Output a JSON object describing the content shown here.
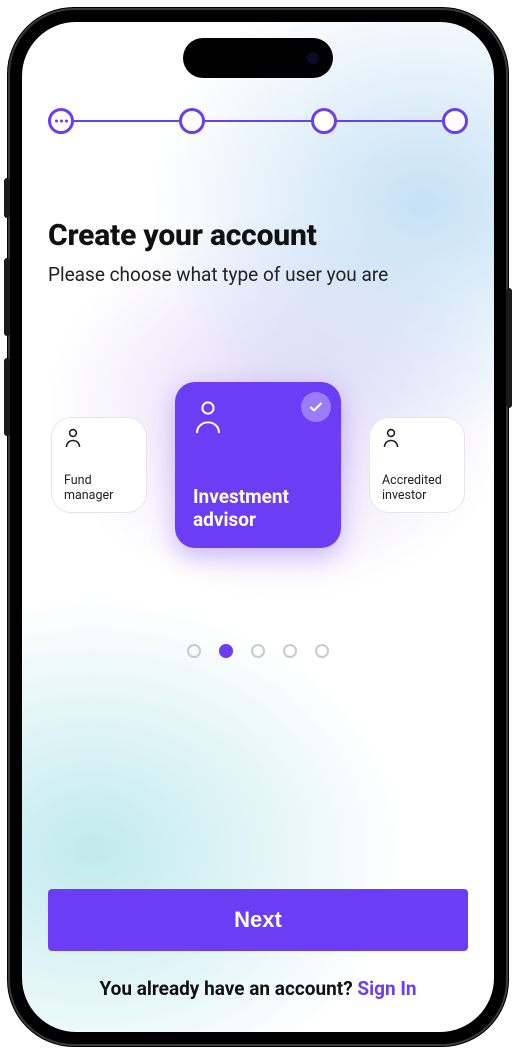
{
  "colors": {
    "accent": "#6b3df5"
  },
  "progress": {
    "steps": 4,
    "current_index": 0
  },
  "heading": {
    "title": "Create your account",
    "subtitle": "Please choose what type of user you are"
  },
  "carousel": {
    "selected_index": 1,
    "options": [
      {
        "id": "fund-manager",
        "label": "Fund manager",
        "icon": "person-icon"
      },
      {
        "id": "investment-advisor",
        "label": "Investment advisor",
        "icon": "person-icon",
        "selected": true
      },
      {
        "id": "accredited-investor",
        "label": "Accredited investor",
        "icon": "person-icon"
      }
    ]
  },
  "pager": {
    "count": 5,
    "active_index": 1
  },
  "cta": {
    "next_label": "Next"
  },
  "signin": {
    "prompt": "You already have an account? ",
    "link_label": "Sign In"
  }
}
